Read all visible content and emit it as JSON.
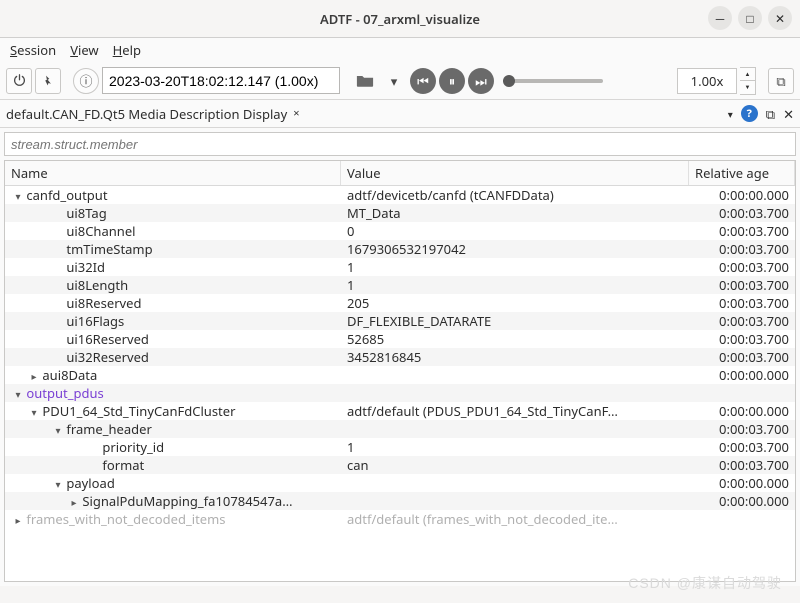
{
  "window": {
    "title": "ADTF - 07_arxml_visualize"
  },
  "menu": {
    "session": "Session",
    "view": "View",
    "help": "Help"
  },
  "toolbar": {
    "timestamp": "2023-03-20T18:02:12.147 (1.00x)",
    "speed": "1.00x"
  },
  "tab": {
    "title": "default.CAN_FD.Qt5 Media Description Display",
    "close": "×",
    "float": "⧉",
    "help": "?"
  },
  "filter": {
    "placeholder": "stream.struct.member"
  },
  "columns": {
    "name": "Name",
    "value": "Value",
    "age": "Relative age"
  },
  "rows": [
    {
      "i": 0,
      "tri": "▾",
      "name": "canfd_output",
      "value": "adtf/devicetb/canfd (tCANFDData)",
      "age": "0:00:00.000"
    },
    {
      "i": 2,
      "name": "ui8Tag",
      "value": "MT_Data",
      "age": "0:00:03.700"
    },
    {
      "i": 2,
      "name": "ui8Channel",
      "value": "0",
      "age": "0:00:03.700"
    },
    {
      "i": 2,
      "name": "tmTimeStamp",
      "value": "1679306532197042",
      "age": "0:00:03.700"
    },
    {
      "i": 2,
      "name": "ui32Id",
      "value": "1",
      "age": "0:00:03.700"
    },
    {
      "i": 2,
      "name": "ui8Length",
      "value": "1",
      "age": "0:00:03.700"
    },
    {
      "i": 2,
      "name": "ui8Reserved",
      "value": "205",
      "age": "0:00:03.700"
    },
    {
      "i": 2,
      "name": "ui16Flags",
      "value": "DF_FLEXIBLE_DATARATE",
      "age": "0:00:03.700"
    },
    {
      "i": 2,
      "name": "ui16Reserved",
      "value": "52685",
      "age": "0:00:03.700"
    },
    {
      "i": 2,
      "name": "ui32Reserved",
      "value": "3452816845",
      "age": "0:00:03.700"
    },
    {
      "i": 1,
      "tri": "▸",
      "name": "aui8Data",
      "value": "",
      "age": "0:00:00.000"
    },
    {
      "i": 0,
      "tri": "▾",
      "cls": "purple",
      "name": "output_pdus",
      "value": "",
      "age": ""
    },
    {
      "i": 1,
      "tri": "▾",
      "name": "PDU1_64_Std_TinyCanFdCluster",
      "value": "adtf/default (PDUS_PDU1_64_Std_TinyCanF…",
      "age": "0:00:00.000"
    },
    {
      "i": 2,
      "tri": "▾",
      "name": "frame_header",
      "value": "",
      "age": "0:00:03.700"
    },
    {
      "i": 4,
      "name": "priority_id",
      "value": "1",
      "age": "0:00:03.700"
    },
    {
      "i": 4,
      "name": "format",
      "value": "can",
      "age": "0:00:03.700"
    },
    {
      "i": 2,
      "tri": "▾",
      "name": "payload",
      "value": "",
      "age": "0:00:00.000"
    },
    {
      "i": 3,
      "tri": "▸",
      "name": "SignalPduMapping_fa10784547a…",
      "value": "",
      "age": "0:00:00.000"
    },
    {
      "i": 0,
      "tri": "▸",
      "cls": "grey",
      "name": "frames_with_not_decoded_items",
      "value": "adtf/default (frames_with_not_decoded_ite…",
      "age": ""
    }
  ],
  "watermark": "CSDN @康谋自动驾驶"
}
